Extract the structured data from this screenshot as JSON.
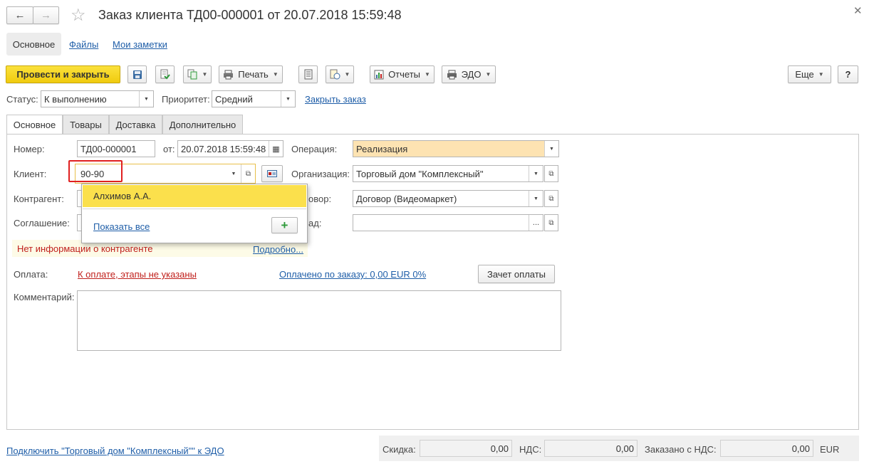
{
  "window": {
    "title": "Заказ клиента ТД00-000001 от 20.07.2018 15:59:48"
  },
  "nav_tabs": [
    {
      "label": "Основное"
    },
    {
      "label": "Файлы"
    },
    {
      "label": "Мои заметки"
    }
  ],
  "toolbar": {
    "post_close_label": "Провести и закрыть",
    "print_label": "Печать",
    "reports_label": "Отчеты",
    "edo_label": "ЭДО",
    "more_label": "Еще",
    "help_label": "?"
  },
  "status_row": {
    "status_label": "Статус:",
    "status_value": "К выполнению",
    "priority_label": "Приоритет:",
    "priority_value": "Средний",
    "close_order_link": "Закрыть заказ"
  },
  "form_tabs": [
    {
      "label": "Основное"
    },
    {
      "label": "Товары"
    },
    {
      "label": "Доставка"
    },
    {
      "label": "Дополнительно"
    }
  ],
  "form": {
    "number_label": "Номер:",
    "number_value": "ТД00-000001",
    "date_label": "от:",
    "date_value": "20.07.2018 15:59:48",
    "operation_label": "Операция:",
    "operation_value": "Реализация",
    "client_label": "Клиент:",
    "client_value": "90-90",
    "organization_label": "Организация:",
    "organization_value": "Торговый дом \"Комплексный\"",
    "counterparty_label": "Контрагент:",
    "contract_label_partial": "овор:",
    "contract_value": "Договор (Видеомаркет)",
    "agreement_label": "Соглашение:",
    "warehouse_label_partial": "ад:",
    "warehouse_value": "",
    "info_warning": "Нет информации о контрагенте",
    "details_link": "Подробно...",
    "payment_label": "Оплата:",
    "payment_link": "К оплате, этапы не указаны",
    "paid_link": "Оплачено по заказу: 0,00 EUR  0%",
    "offset_button": "Зачет оплаты",
    "comment_label": "Комментарий:",
    "comment_value": ""
  },
  "dropdown": {
    "items": [
      {
        "label": "Алхимов А.А."
      }
    ],
    "show_all_link": "Показать все"
  },
  "footer": {
    "edo_link": "Подключить \"Торговый дом \"Комплексный\"\" к ЭДО",
    "discount_label": "Скидка:",
    "discount_value": "0,00",
    "vat_label": "НДС:",
    "vat_value": "0,00",
    "total_label": "Заказано с НДС:",
    "total_value": "0,00",
    "currency": "EUR"
  },
  "colors": {
    "primary_button": "#f5d31a",
    "operation_field": "#fde3b2",
    "dropdown_selected": "#fbe04c",
    "highlight_border": "#e02020",
    "link": "#1f5ea8",
    "warning_text": "#c0201c",
    "warning_bg": "#fdfbe7"
  }
}
